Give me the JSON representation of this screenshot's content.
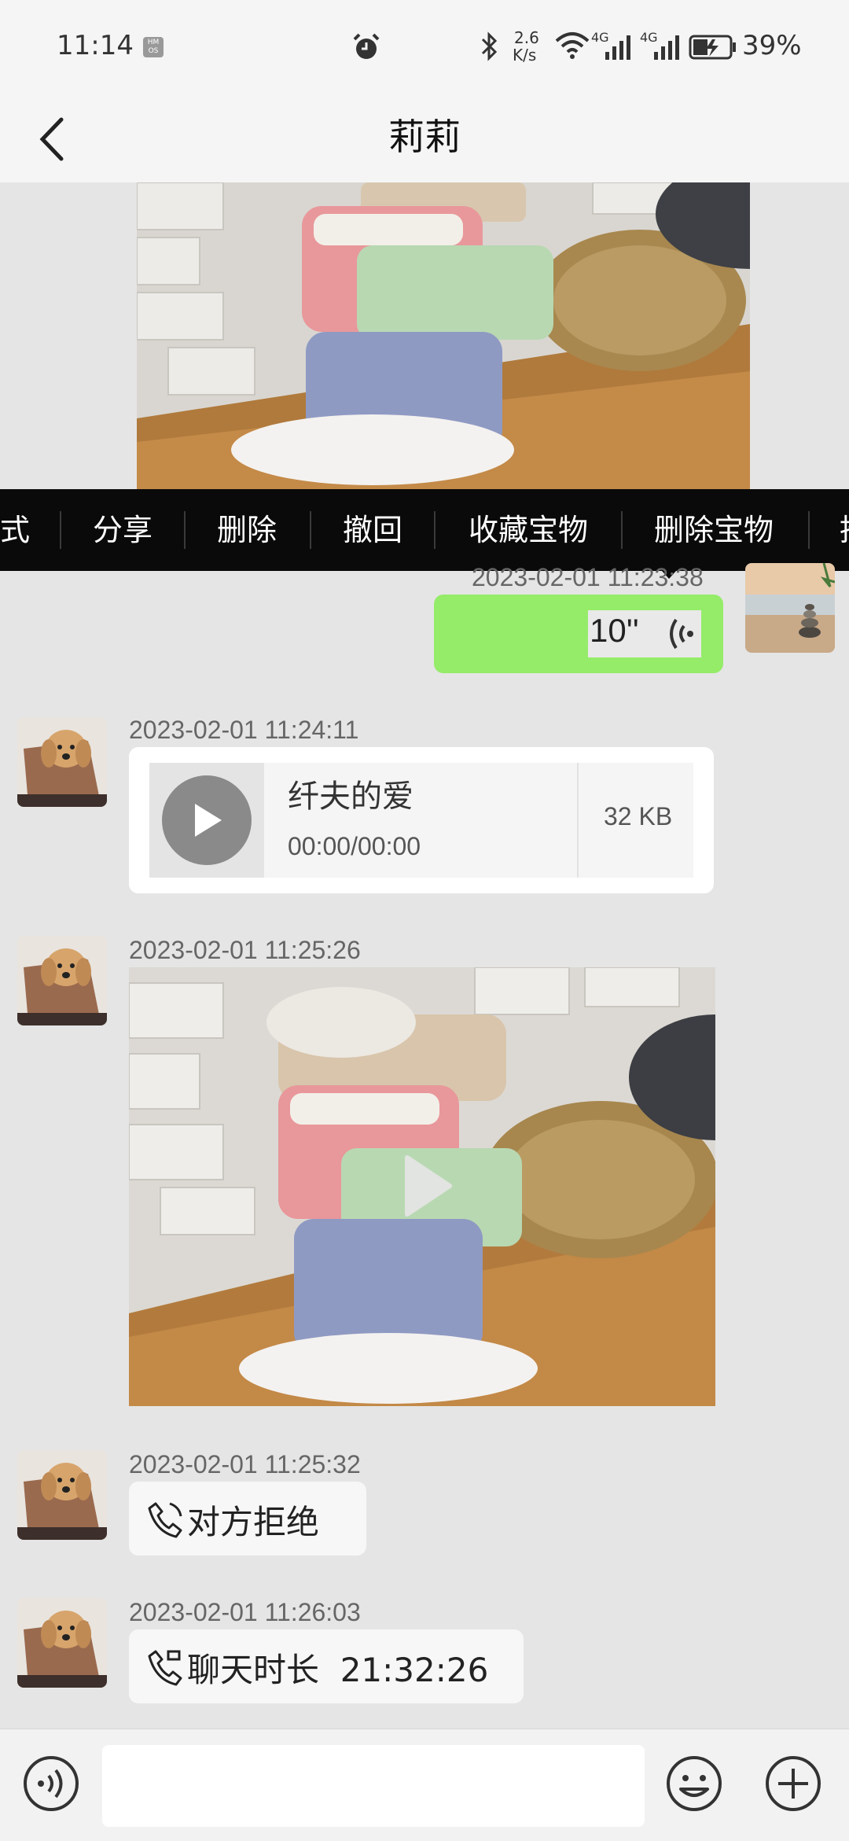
{
  "status_bar": {
    "time": "11:14",
    "os_badge": "HM OS",
    "net_speed_value": "2.6",
    "net_speed_unit": "K/s",
    "sig1_label": "4G",
    "sig2_label": "4G",
    "battery_percent": "39%",
    "icons": [
      "alarm-icon",
      "bluetooth-icon",
      "wifi-icon",
      "signal-icon",
      "battery-icon"
    ]
  },
  "header": {
    "title": "莉莉",
    "back_icon": "chevron-left-icon"
  },
  "context_menu": {
    "items": [
      "式",
      "分享",
      "删除",
      "撤回",
      "收藏宝物",
      "删除宝物",
      "推"
    ]
  },
  "messages": [
    {
      "type": "image",
      "side": "left",
      "content": "storage-rack-photo"
    },
    {
      "type": "voice",
      "side": "right",
      "timestamp": "2023-02-01 11:23:38",
      "duration": "10''",
      "bubble_color": "#95ec69"
    },
    {
      "type": "audio_file",
      "side": "left",
      "timestamp": "2023-02-01 11:24:11",
      "title": "纤夫的爱",
      "time": "00:00/00:00",
      "size": "32 KB"
    },
    {
      "type": "video",
      "side": "left",
      "timestamp": "2023-02-01 11:25:26"
    },
    {
      "type": "call",
      "side": "left",
      "timestamp": "2023-02-01 11:25:32",
      "text": "对方拒绝"
    },
    {
      "type": "call",
      "side": "left",
      "timestamp": "2023-02-01 11:26:03",
      "text": "聊天时长  21:32:26"
    }
  ],
  "input_bar": {
    "placeholder": "",
    "icons": [
      "voice-input-icon",
      "emoji-icon",
      "plus-icon"
    ]
  },
  "colors": {
    "accent_green": "#95ec69",
    "background": "#e5e5e5",
    "menu_bg": "#0a0a0a"
  }
}
